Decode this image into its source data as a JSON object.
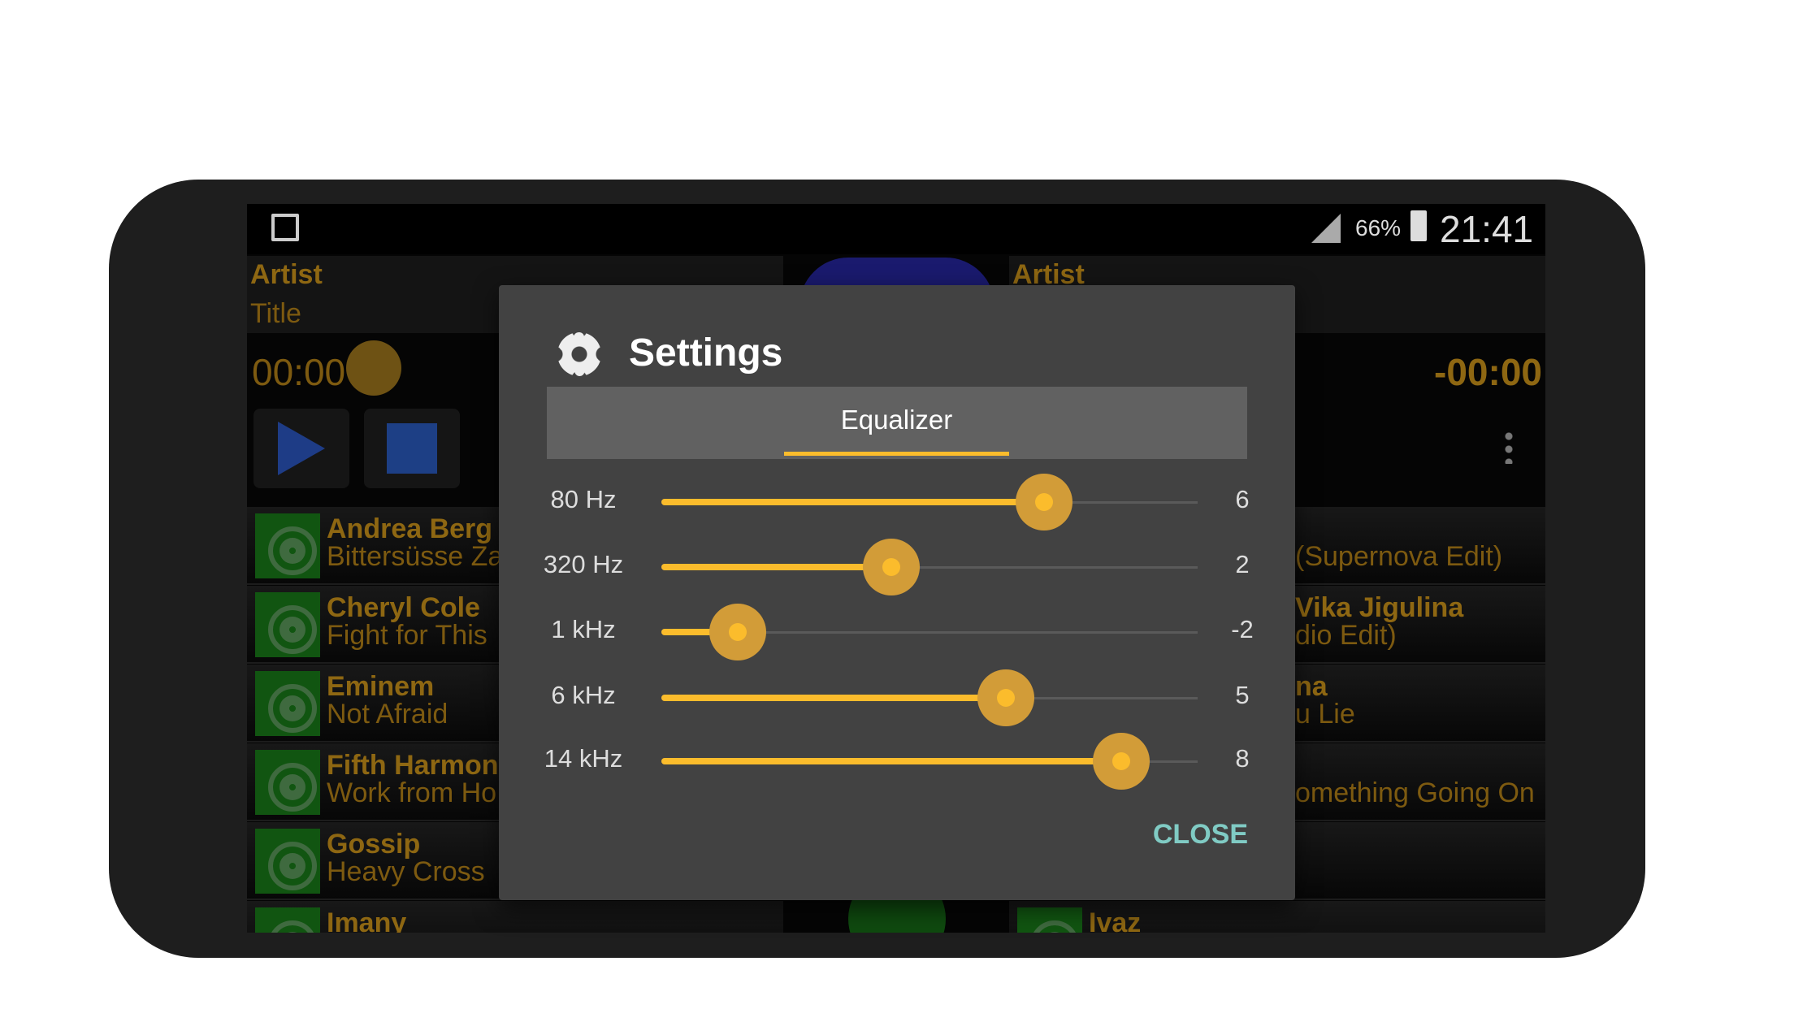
{
  "status_bar": {
    "battery": "66%",
    "time": "21:41"
  },
  "player": {
    "left": {
      "artist": "Artist",
      "title": "Title",
      "time": "00:00"
    },
    "right": {
      "artist": "Artist",
      "time": "-00:00"
    }
  },
  "left_list": [
    {
      "artist": "Andrea Berg",
      "title": "Bittersüsse Za"
    },
    {
      "artist": "Cheryl Cole",
      "title": "Fight for This"
    },
    {
      "artist": "Eminem",
      "title": "Not Afraid"
    },
    {
      "artist": "Fifth Harmony",
      "title": "Work from Ho"
    },
    {
      "artist": "Gossip",
      "title": "Heavy Cross"
    },
    {
      "artist": "Imany",
      "title": ""
    }
  ],
  "right_list": [
    {
      "artist": "",
      "title": "(Supernova Edit)"
    },
    {
      "artist": "Vika Jigulina",
      "title": "dio Edit)"
    },
    {
      "artist": "na",
      "title": "u Lie"
    },
    {
      "artist": "",
      "title": "omething Going On"
    },
    {
      "artist": "",
      "title": ""
    },
    {
      "artist": "Ivaz",
      "title": ""
    }
  ],
  "dialog": {
    "title": "Settings",
    "tab": "Equalizer",
    "close": "CLOSE",
    "eq_range": [
      -4,
      10
    ],
    "bands": [
      {
        "label": "80 Hz",
        "value": 6
      },
      {
        "label": "320 Hz",
        "value": 2
      },
      {
        "label": "1 kHz",
        "value": -2
      },
      {
        "label": "6 kHz",
        "value": 5
      },
      {
        "label": "14 kHz",
        "value": 8
      }
    ]
  },
  "colors": {
    "accent": "#fbbc2c",
    "close": "#80cbc4",
    "dialog": "#424242",
    "tabbar": "#616161"
  }
}
